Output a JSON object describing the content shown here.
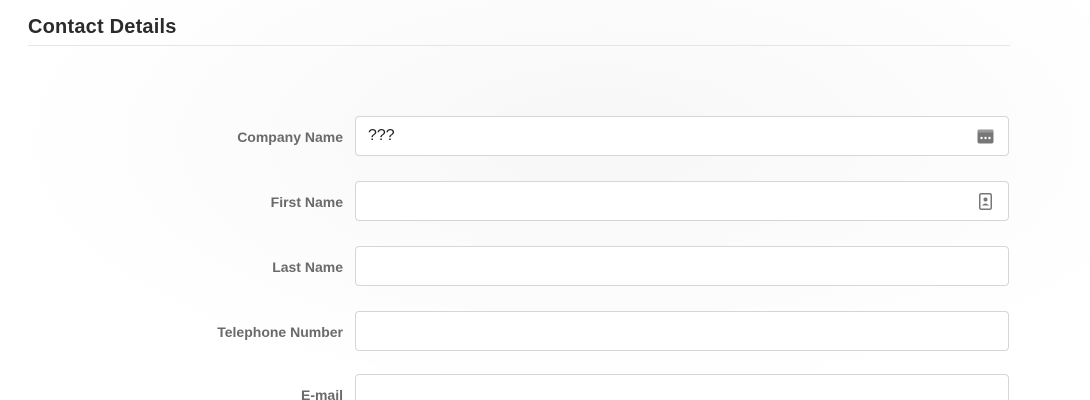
{
  "section": {
    "title": "Contact Details"
  },
  "fields": {
    "company_name": {
      "label": "Company Name",
      "value": "???",
      "icon": "password-manager-icon"
    },
    "first_name": {
      "label": "First Name",
      "value": "",
      "icon": "contact-card-icon"
    },
    "last_name": {
      "label": "Last Name",
      "value": ""
    },
    "telephone": {
      "label": "Telephone Number",
      "value": ""
    },
    "email": {
      "label": "E-mail",
      "value": ""
    }
  }
}
